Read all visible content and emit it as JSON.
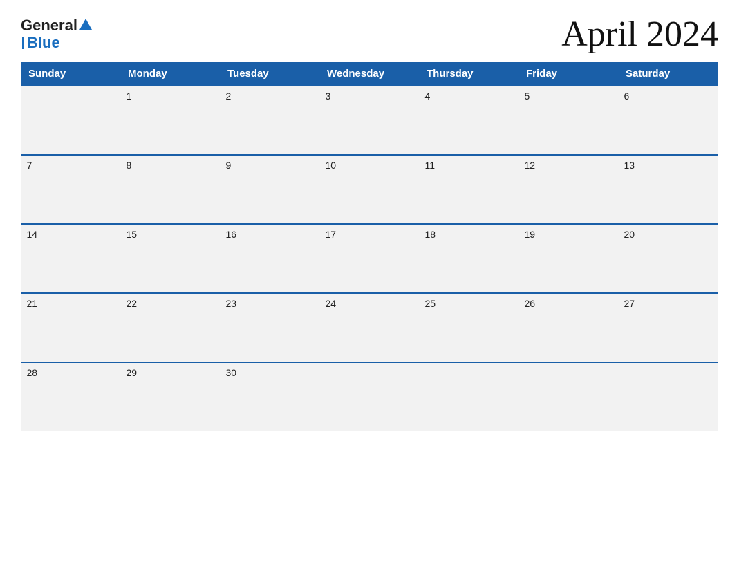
{
  "logo": {
    "general": "General",
    "blue": "Blue"
  },
  "title": "April 2024",
  "days": [
    "Sunday",
    "Monday",
    "Tuesday",
    "Wednesday",
    "Thursday",
    "Friday",
    "Saturday"
  ],
  "weeks": [
    [
      "",
      "1",
      "2",
      "3",
      "4",
      "5",
      "6"
    ],
    [
      "7",
      "8",
      "9",
      "10",
      "11",
      "12",
      "13"
    ],
    [
      "14",
      "15",
      "16",
      "17",
      "18",
      "19",
      "20"
    ],
    [
      "21",
      "22",
      "23",
      "24",
      "25",
      "26",
      "27"
    ],
    [
      "28",
      "29",
      "30",
      "",
      "",
      "",
      ""
    ]
  ]
}
